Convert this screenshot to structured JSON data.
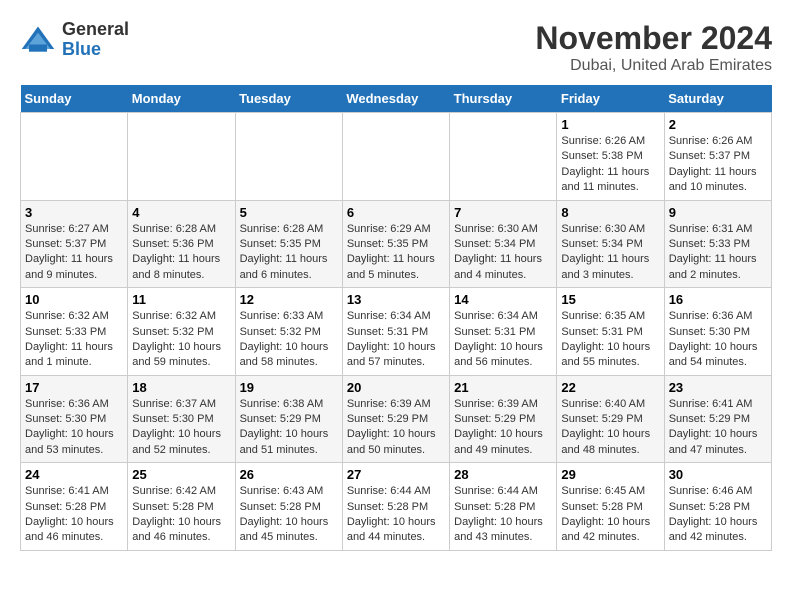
{
  "logo": {
    "general": "General",
    "blue": "Blue"
  },
  "title": "November 2024",
  "subtitle": "Dubai, United Arab Emirates",
  "weekdays": [
    "Sunday",
    "Monday",
    "Tuesday",
    "Wednesday",
    "Thursday",
    "Friday",
    "Saturday"
  ],
  "weeks": [
    [
      {
        "day": "",
        "info": ""
      },
      {
        "day": "",
        "info": ""
      },
      {
        "day": "",
        "info": ""
      },
      {
        "day": "",
        "info": ""
      },
      {
        "day": "",
        "info": ""
      },
      {
        "day": "1",
        "info": "Sunrise: 6:26 AM\nSunset: 5:38 PM\nDaylight: 11 hours and 11 minutes."
      },
      {
        "day": "2",
        "info": "Sunrise: 6:26 AM\nSunset: 5:37 PM\nDaylight: 11 hours and 10 minutes."
      }
    ],
    [
      {
        "day": "3",
        "info": "Sunrise: 6:27 AM\nSunset: 5:37 PM\nDaylight: 11 hours and 9 minutes."
      },
      {
        "day": "4",
        "info": "Sunrise: 6:28 AM\nSunset: 5:36 PM\nDaylight: 11 hours and 8 minutes."
      },
      {
        "day": "5",
        "info": "Sunrise: 6:28 AM\nSunset: 5:35 PM\nDaylight: 11 hours and 6 minutes."
      },
      {
        "day": "6",
        "info": "Sunrise: 6:29 AM\nSunset: 5:35 PM\nDaylight: 11 hours and 5 minutes."
      },
      {
        "day": "7",
        "info": "Sunrise: 6:30 AM\nSunset: 5:34 PM\nDaylight: 11 hours and 4 minutes."
      },
      {
        "day": "8",
        "info": "Sunrise: 6:30 AM\nSunset: 5:34 PM\nDaylight: 11 hours and 3 minutes."
      },
      {
        "day": "9",
        "info": "Sunrise: 6:31 AM\nSunset: 5:33 PM\nDaylight: 11 hours and 2 minutes."
      }
    ],
    [
      {
        "day": "10",
        "info": "Sunrise: 6:32 AM\nSunset: 5:33 PM\nDaylight: 11 hours and 1 minute."
      },
      {
        "day": "11",
        "info": "Sunrise: 6:32 AM\nSunset: 5:32 PM\nDaylight: 10 hours and 59 minutes."
      },
      {
        "day": "12",
        "info": "Sunrise: 6:33 AM\nSunset: 5:32 PM\nDaylight: 10 hours and 58 minutes."
      },
      {
        "day": "13",
        "info": "Sunrise: 6:34 AM\nSunset: 5:31 PM\nDaylight: 10 hours and 57 minutes."
      },
      {
        "day": "14",
        "info": "Sunrise: 6:34 AM\nSunset: 5:31 PM\nDaylight: 10 hours and 56 minutes."
      },
      {
        "day": "15",
        "info": "Sunrise: 6:35 AM\nSunset: 5:31 PM\nDaylight: 10 hours and 55 minutes."
      },
      {
        "day": "16",
        "info": "Sunrise: 6:36 AM\nSunset: 5:30 PM\nDaylight: 10 hours and 54 minutes."
      }
    ],
    [
      {
        "day": "17",
        "info": "Sunrise: 6:36 AM\nSunset: 5:30 PM\nDaylight: 10 hours and 53 minutes."
      },
      {
        "day": "18",
        "info": "Sunrise: 6:37 AM\nSunset: 5:30 PM\nDaylight: 10 hours and 52 minutes."
      },
      {
        "day": "19",
        "info": "Sunrise: 6:38 AM\nSunset: 5:29 PM\nDaylight: 10 hours and 51 minutes."
      },
      {
        "day": "20",
        "info": "Sunrise: 6:39 AM\nSunset: 5:29 PM\nDaylight: 10 hours and 50 minutes."
      },
      {
        "day": "21",
        "info": "Sunrise: 6:39 AM\nSunset: 5:29 PM\nDaylight: 10 hours and 49 minutes."
      },
      {
        "day": "22",
        "info": "Sunrise: 6:40 AM\nSunset: 5:29 PM\nDaylight: 10 hours and 48 minutes."
      },
      {
        "day": "23",
        "info": "Sunrise: 6:41 AM\nSunset: 5:29 PM\nDaylight: 10 hours and 47 minutes."
      }
    ],
    [
      {
        "day": "24",
        "info": "Sunrise: 6:41 AM\nSunset: 5:28 PM\nDaylight: 10 hours and 46 minutes."
      },
      {
        "day": "25",
        "info": "Sunrise: 6:42 AM\nSunset: 5:28 PM\nDaylight: 10 hours and 46 minutes."
      },
      {
        "day": "26",
        "info": "Sunrise: 6:43 AM\nSunset: 5:28 PM\nDaylight: 10 hours and 45 minutes."
      },
      {
        "day": "27",
        "info": "Sunrise: 6:44 AM\nSunset: 5:28 PM\nDaylight: 10 hours and 44 minutes."
      },
      {
        "day": "28",
        "info": "Sunrise: 6:44 AM\nSunset: 5:28 PM\nDaylight: 10 hours and 43 minutes."
      },
      {
        "day": "29",
        "info": "Sunrise: 6:45 AM\nSunset: 5:28 PM\nDaylight: 10 hours and 42 minutes."
      },
      {
        "day": "30",
        "info": "Sunrise: 6:46 AM\nSunset: 5:28 PM\nDaylight: 10 hours and 42 minutes."
      }
    ]
  ]
}
